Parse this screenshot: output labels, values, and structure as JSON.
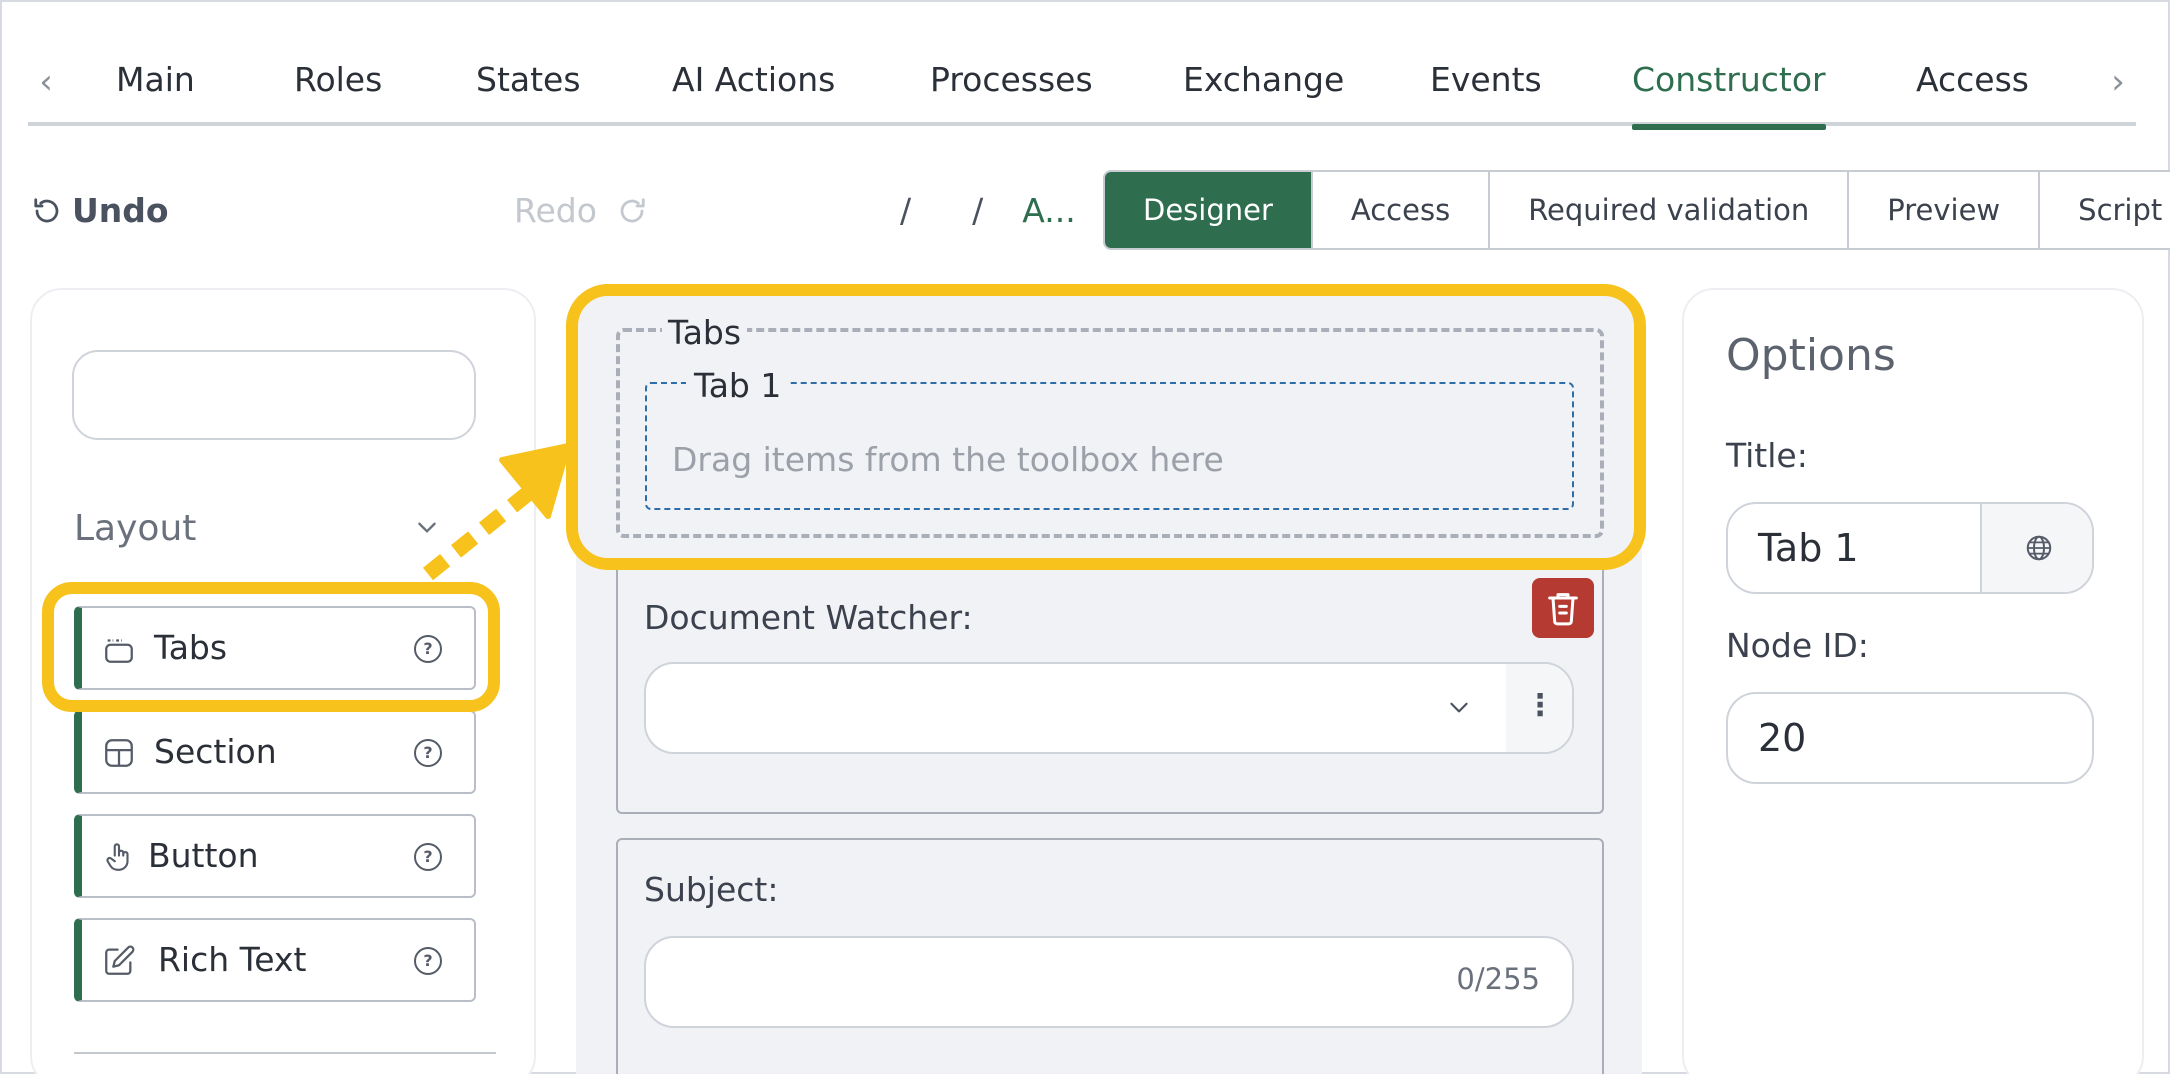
{
  "nav": {
    "prev_label": "‹",
    "next_label": "›",
    "tabs": [
      {
        "label": "Main"
      },
      {
        "label": "Roles"
      },
      {
        "label": "States"
      },
      {
        "label": "AI Actions"
      },
      {
        "label": "Processes"
      },
      {
        "label": "Exchange"
      },
      {
        "label": "Events"
      },
      {
        "label": "Constructor"
      },
      {
        "label": "Access"
      }
    ],
    "active_tab": "Constructor"
  },
  "toolbar": {
    "undo_label": "Undo",
    "redo_label": "Redo",
    "breadcrumb_sep1": "/",
    "breadcrumb_sep2": "/",
    "breadcrumb_current": "A...",
    "modes": [
      {
        "label": "Designer"
      },
      {
        "label": "Access"
      },
      {
        "label": "Required validation"
      },
      {
        "label": "Preview"
      },
      {
        "label": "Script"
      }
    ],
    "active_mode": "Designer"
  },
  "toolbox": {
    "search_value": "",
    "section_title": "Layout",
    "items": [
      {
        "label": "Tabs",
        "icon": "tabs-icon"
      },
      {
        "label": "Section",
        "icon": "section-icon"
      },
      {
        "label": "Button",
        "icon": "pointer-hand-icon"
      },
      {
        "label": "Rich Text",
        "icon": "edit-icon"
      }
    ],
    "help_glyph": "?"
  },
  "canvas": {
    "tabs_legend": "Tabs",
    "tab_legend": "Tab 1",
    "drop_hint": "Drag items from the toolbox here",
    "watcher_label": "Document Watcher:",
    "watcher_value": "",
    "more_glyph": "⋮",
    "subject_label": "Subject:",
    "subject_value": "",
    "subject_counter": "0/255"
  },
  "options": {
    "title": "Options",
    "title_label": "Title:",
    "title_value": "Tab 1",
    "node_id_label": "Node ID:",
    "node_id_value": "20"
  },
  "colors": {
    "accent": "#2e6e4f",
    "highlight": "#f7c21c",
    "danger": "#b53a32"
  }
}
